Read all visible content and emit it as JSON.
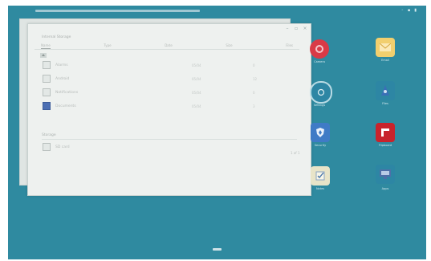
{
  "window": {
    "folder_label": "Internal Storage",
    "tabs": [
      {
        "label": "Name"
      },
      {
        "label": "Type"
      },
      {
        "label": "Date"
      },
      {
        "label": "Size"
      },
      {
        "label": "Files"
      }
    ],
    "files": [
      {
        "name": "Alarms",
        "date": "05/04",
        "size": "0"
      },
      {
        "name": "Android",
        "date": "05/04",
        "size": "12"
      },
      {
        "name": "Notifications",
        "date": "05/04",
        "size": "0"
      },
      {
        "name": "Documents",
        "date": "05/04",
        "size": "3"
      }
    ],
    "section": {
      "header": "Storage",
      "item": "SD card"
    },
    "page_indicator": "1 of 1"
  },
  "apps": [
    {
      "name": "Camera",
      "icon": "camera-icon",
      "color": "#d93a46"
    },
    {
      "name": "Email",
      "icon": "email-icon",
      "color": "#f2cf6e"
    },
    {
      "name": "Settings",
      "icon": "gear-icon",
      "color": "#3b7db8"
    },
    {
      "name": "Files",
      "icon": "file-manager-icon",
      "color": "#3a6fb6"
    },
    {
      "name": "Security",
      "icon": "shield-icon",
      "color": "#3f7bc6"
    },
    {
      "name": "Flipboard",
      "icon": "flipboard-icon",
      "color": "#c8232c"
    },
    {
      "name": "Notes",
      "icon": "notes-icon",
      "color": "#e8e4c8"
    },
    {
      "name": "Apps",
      "icon": "app-grid-icon",
      "color": "#4e6fa8"
    }
  ],
  "colors": {
    "wallpaper": "#2f8aa0",
    "window_bg": "#eef1ef"
  }
}
